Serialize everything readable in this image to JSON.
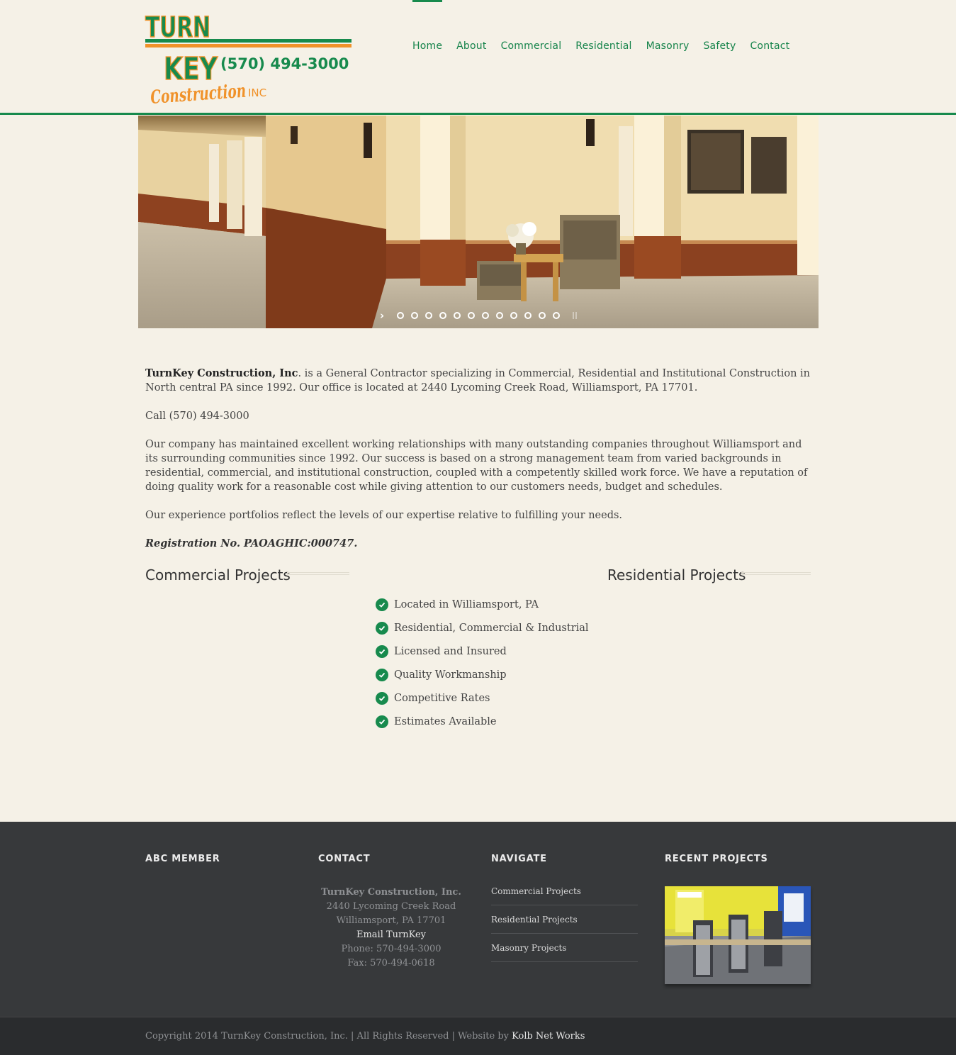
{
  "brand": {
    "line1": "TURN",
    "line2": "KEY",
    "phone": "(570) 494-3000",
    "script": "Construction",
    "suffix": "INC",
    "colors": {
      "green": "#178a4d",
      "orange": "#f0922a"
    }
  },
  "nav": {
    "items": [
      {
        "label": "Home",
        "active": true
      },
      {
        "label": "About"
      },
      {
        "label": "Commercial"
      },
      {
        "label": "Residential"
      },
      {
        "label": "Masonry"
      },
      {
        "label": "Safety"
      },
      {
        "label": "Contact"
      }
    ]
  },
  "slider": {
    "slides": 12,
    "arrow_icon": "chevron-right-icon"
  },
  "intro": {
    "company": "TurnKey Construction, Inc",
    "p1_rest": ". is a General Contractor specializing in Commercial, Residential and Institutional Construction in North central PA since 1992. Our office is located at 2440 Lycoming Creek Road, Williamsport, PA 17701.",
    "p2": "Call (570) 494-3000",
    "p3": "Our company has maintained excellent working relationships with many outstanding companies throughout Williamsport and its surrounding communities since 1992. Our success is based on a strong management team from varied backgrounds in residential, commercial, and institutional construction, coupled with a competently skilled work force. We have a reputation of doing quality work for a reasonable cost while giving attention to our customers needs, budget and schedules.",
    "p4": "Our experience portfolios reflect the levels of our expertise relative to fulfilling your needs.",
    "registration": "Registration No. PAOAGHIC:000747."
  },
  "sections": {
    "commercial_title": "Commercial Projects",
    "residential_title": "Residential Projects"
  },
  "features": [
    "Located in Williamsport, PA",
    "Residential, Commercial & Industrial",
    "Licensed and Insured",
    "Quality Workmanship",
    "Competitive Rates",
    "Estimates Available"
  ],
  "footer": {
    "abc_heading": "ABC MEMBER",
    "contact_heading": "CONTACT",
    "navigate_heading": "NAVIGATE",
    "recent_heading": "RECENT PROJECTS",
    "contact": {
      "name": "TurnKey Construction, Inc.",
      "address1": "2440 Lycoming Creek Road",
      "address2": "Williamsport, PA 17701",
      "email": "Email TurnKey",
      "phone": "Phone: 570-494-3000",
      "fax": "Fax: 570-494-0618"
    },
    "navigate": [
      "Commercial Projects",
      "Residential Projects",
      "Masonry Projects"
    ],
    "copyright": "Copyright 2014 TurnKey Construction, Inc. | All Rights Reserved | Website by ",
    "credit": "Kolb Net Works"
  }
}
